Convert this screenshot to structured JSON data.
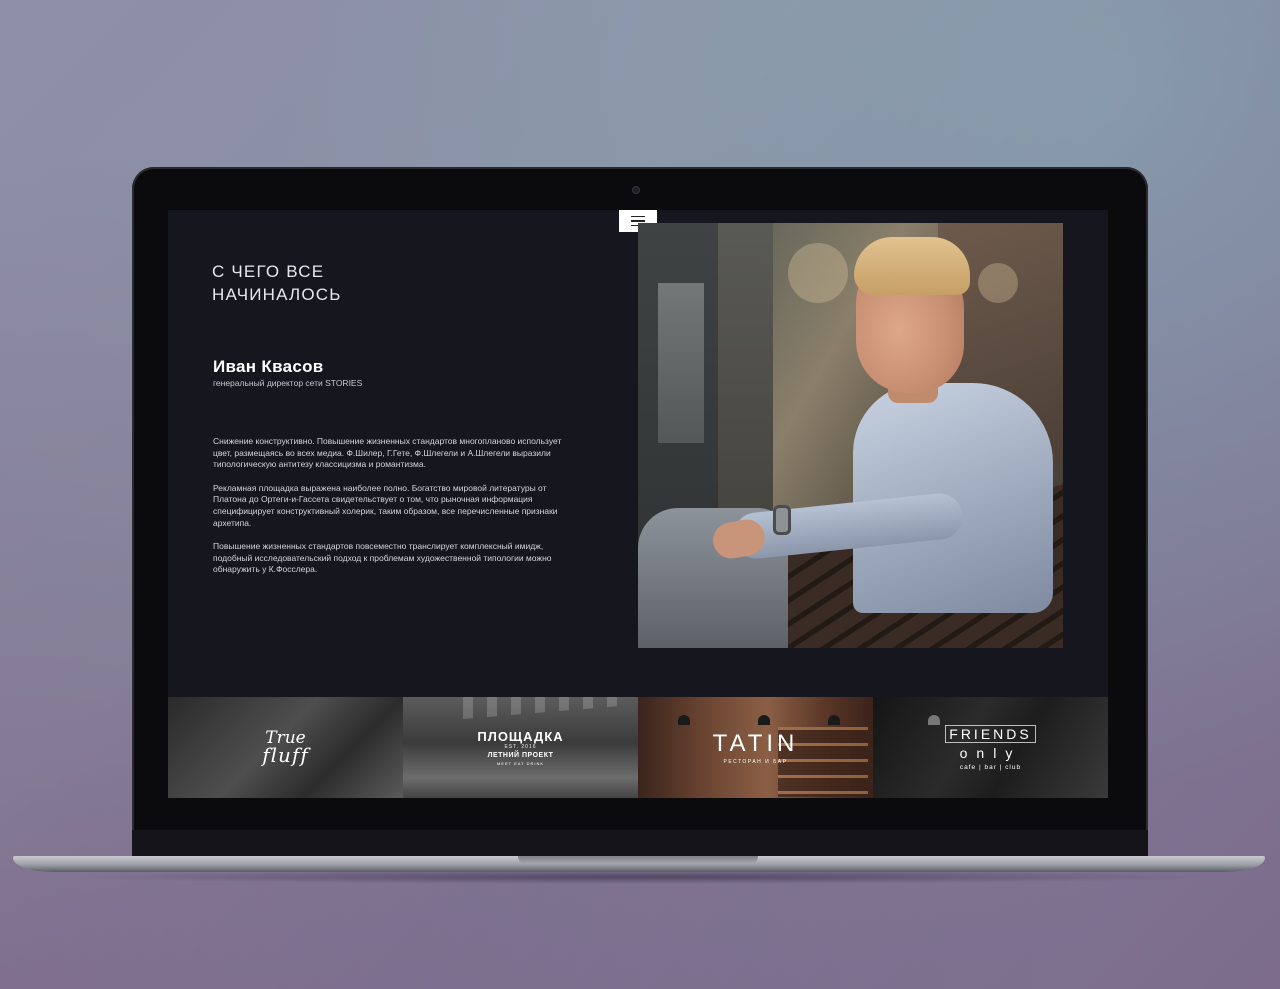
{
  "hero": {
    "headline_line1": "С ЧЕГО ВСЕ",
    "headline_line2": "НАЧИНАЛОСЬ",
    "name": "Иван Квасов",
    "role": "генеральный директор сети STORIES",
    "paragraphs": [
      "Снижение конструктивно. Повышение жизненных стандартов многопланово использует цвет, размещаясь во всех медиа. Ф.Шилер, Г.Гете, Ф.Шлегели и А.Шлегели выразили типологическую антитезу классицизма и романтизма.",
      "Рекламная площадка выражена наиболее полно. Богатство мировой литературы от Платона до Ортеги-и-Гассета свидетельствует о том, что рыночная информация специфицирует конструктивный холерик, таким образом, все перечисленные признаки архетипа.",
      "Повышение жизненных стандартов повсеместно транслирует комплексный имидж, подобный исследовательский подход к проблемам художественной типологии можно обнаружить у К.Фосслера."
    ]
  },
  "tiles": [
    {
      "line1": "True",
      "line2": "fluff"
    },
    {
      "line1": "ПЛОЩАДКА",
      "line2": "EST. 2016",
      "line3": "ЛЕТНИЙ ПРОЕКТ",
      "line4": "MEET EAT DRINK"
    },
    {
      "line1": "TATIN",
      "line2": "РЕСТОРАН И БАР"
    },
    {
      "line1": "FRIENDS",
      "line2": "only",
      "line3": "cafe | bar | club"
    }
  ],
  "colors": {
    "screen_bg": "#15161e",
    "text_primary": "#ffffff"
  }
}
